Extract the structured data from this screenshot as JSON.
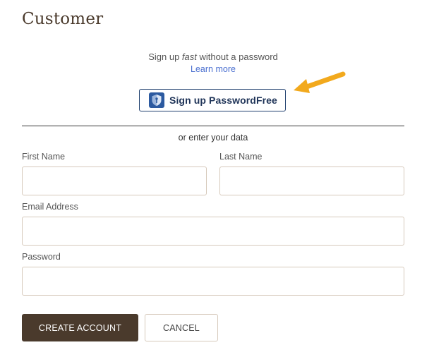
{
  "page": {
    "title": "Customer"
  },
  "passwordfree": {
    "line_prefix": "Sign up ",
    "line_emphasis": "fast",
    "line_suffix": " without a password",
    "learn_more": "Learn more",
    "button_label": "Sign up PasswordFree",
    "icon": "passwordfree-shield-icon"
  },
  "divider_text": "or enter your data",
  "form": {
    "first_name": {
      "label": "First Name",
      "value": ""
    },
    "last_name": {
      "label": "Last Name",
      "value": ""
    },
    "email": {
      "label": "Email Address",
      "value": ""
    },
    "password": {
      "label": "Password",
      "value": ""
    }
  },
  "actions": {
    "create": "CREATE ACCOUNT",
    "cancel": "CANCEL"
  },
  "colors": {
    "brand_brown": "#4a3a2c",
    "link_blue": "#4a6fd0",
    "pf_navy": "#1f3f6e",
    "arrow_orange": "#f2a91d",
    "input_border": "#d6c9bb"
  }
}
